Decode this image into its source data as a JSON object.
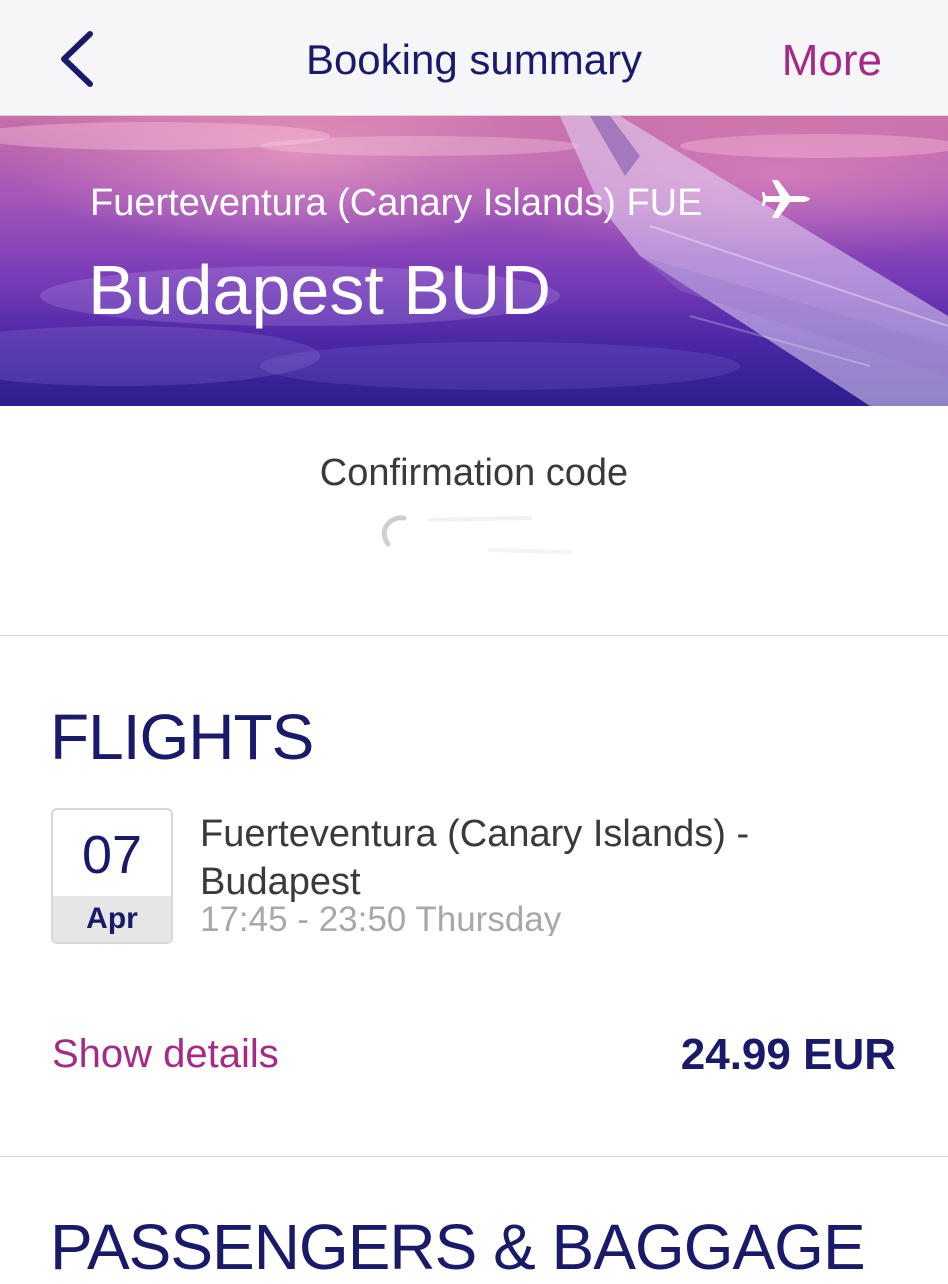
{
  "navbar": {
    "back_icon": "chevron-left-icon",
    "title": "Booking summary",
    "more_label": "More",
    "accent_color": "#a52a86",
    "title_color": "#1a1a6b"
  },
  "hero": {
    "origin": "Fuerteventura (Canary Islands) FUE",
    "destination": "Budapest BUD",
    "plane_icon": "airplane-icon"
  },
  "confirmation": {
    "title": "Confirmation code"
  },
  "flights": {
    "section_title": "FLIGHTS",
    "items": [
      {
        "day": "07",
        "month": "Apr",
        "route": "Fuerteventura (Canary Islands) - Budapest",
        "time": "17:45 - 23:50 Thursday"
      }
    ],
    "show_details_label": "Show details",
    "price": "24.99 EUR"
  },
  "passengers": {
    "section_title": "PASSENGERS & BAGGAGE"
  }
}
